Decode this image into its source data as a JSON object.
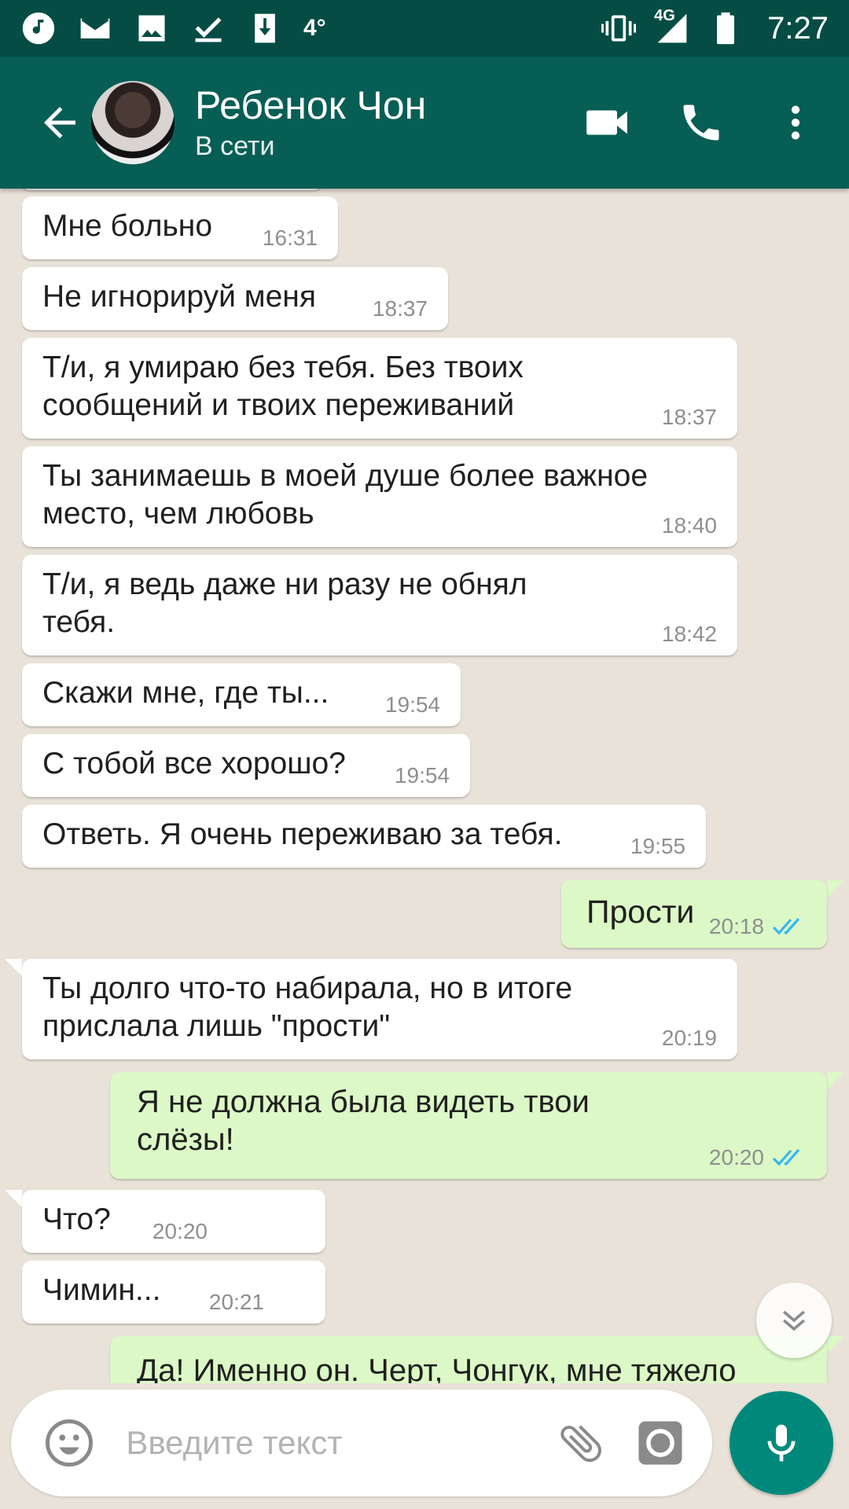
{
  "status_bar": {
    "temperature": "4°",
    "network": "4G",
    "time": "7:27",
    "icons": [
      "music-note-icon",
      "mail-icon",
      "image-icon",
      "check-icon",
      "download-icon",
      "vibrate-icon",
      "signal-icon",
      "battery-icon"
    ]
  },
  "header": {
    "contact_name": "Ребенок Чон",
    "contact_status": "В сети",
    "icons": [
      "back-arrow-icon",
      "video-call-icon",
      "phone-icon",
      "more-vert-icon"
    ]
  },
  "messages": [
    {
      "dir": "in",
      "text": "Мне больно",
      "time": "16:31"
    },
    {
      "dir": "in",
      "text": "Не игнорируй меня",
      "time": "18:37"
    },
    {
      "dir": "in",
      "text": "Т/и, я умираю без тебя. Без твоих\nсообщений и твоих переживаний",
      "time": "18:37"
    },
    {
      "dir": "in",
      "text": "Ты занимаешь в моей душе более важное\nместо, чем любовь",
      "time": "18:40"
    },
    {
      "dir": "in",
      "text": "Т/и, я ведь даже ни разу не обнял\nтебя.",
      "time": "18:42"
    },
    {
      "dir": "in",
      "text": "Скажи мне, где ты...",
      "time": "19:54"
    },
    {
      "dir": "in",
      "text": "С тобой все хорошо?",
      "time": "19:54"
    },
    {
      "dir": "in",
      "text": "Ответь. Я очень переживаю за тебя.",
      "time": "19:55"
    },
    {
      "dir": "out",
      "text": "Прости",
      "time": "20:18",
      "status": "read"
    },
    {
      "dir": "in",
      "text": "Ты долго что-то набирала, но в итоге\nприслала лишь \"прости\"",
      "time": "20:19"
    },
    {
      "dir": "out",
      "text": "Я не должна была видеть твои\nслёзы!",
      "time": "20:20",
      "status": "read"
    },
    {
      "dir": "in",
      "text": "Что?",
      "time": "20:20"
    },
    {
      "dir": "in",
      "text": "Чимин...",
      "time": "20:21"
    },
    {
      "dir": "out",
      "text": "Да! Именно он. Черт, Чонгук, мне тяжело",
      "time": ""
    }
  ],
  "input": {
    "placeholder": "Введите текст",
    "value": ""
  },
  "colors": {
    "header": "#075e54",
    "status_bar": "#054d44",
    "outgoing_bubble": "#dcf8c6",
    "incoming_bubble": "#ffffff",
    "read_ticks": "#34b7f1",
    "mic_button": "#00897b",
    "chat_background": "#e9e2d9"
  }
}
